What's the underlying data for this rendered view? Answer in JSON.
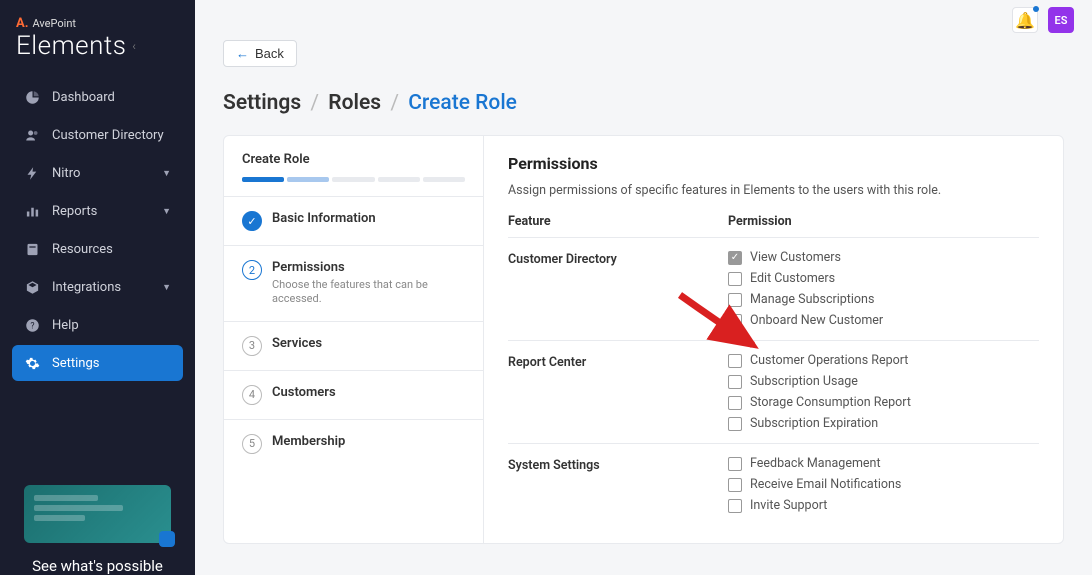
{
  "brand": {
    "top": "AvePoint",
    "main": "Elements"
  },
  "sidebar": {
    "items": [
      {
        "label": "Dashboard",
        "icon": "pie"
      },
      {
        "label": "Customer Directory",
        "icon": "users"
      },
      {
        "label": "Nitro",
        "icon": "bolt",
        "expandable": true
      },
      {
        "label": "Reports",
        "icon": "bars",
        "expandable": true
      },
      {
        "label": "Resources",
        "icon": "book"
      },
      {
        "label": "Integrations",
        "icon": "cube",
        "expandable": true
      },
      {
        "label": "Help",
        "icon": "help"
      },
      {
        "label": "Settings",
        "icon": "gear",
        "active": true
      }
    ],
    "promo": "See what's possible"
  },
  "topbar": {
    "avatar": "ES"
  },
  "back_label": "Back",
  "breadcrumb": {
    "a": "Settings",
    "b": "Roles",
    "c": "Create Role"
  },
  "wizard": {
    "title": "Create Role",
    "steps": [
      {
        "n": "✓",
        "label": "Basic Information",
        "state": "done"
      },
      {
        "n": "2",
        "label": "Permissions",
        "desc": "Choose the features that can be accessed.",
        "state": "active"
      },
      {
        "n": "3",
        "label": "Services"
      },
      {
        "n": "4",
        "label": "Customers"
      },
      {
        "n": "5",
        "label": "Membership"
      }
    ]
  },
  "permissions": {
    "title": "Permissions",
    "subtitle": "Assign permissions of specific features in Elements to the users with this role.",
    "col_feature": "Feature",
    "col_permission": "Permission",
    "groups": [
      {
        "feature": "Customer Directory",
        "perms": [
          {
            "label": "View Customers",
            "checked": true,
            "disabled": true
          },
          {
            "label": "Edit Customers"
          },
          {
            "label": "Manage Subscriptions"
          },
          {
            "label": "Onboard New Customer"
          }
        ]
      },
      {
        "feature": "Report Center",
        "perms": [
          {
            "label": "Customer Operations Report"
          },
          {
            "label": "Subscription Usage"
          },
          {
            "label": "Storage Consumption Report"
          },
          {
            "label": "Subscription Expiration"
          }
        ]
      },
      {
        "feature": "System Settings",
        "perms": [
          {
            "label": "Feedback Management"
          },
          {
            "label": "Receive Email Notifications"
          },
          {
            "label": "Invite Support"
          }
        ]
      }
    ]
  }
}
